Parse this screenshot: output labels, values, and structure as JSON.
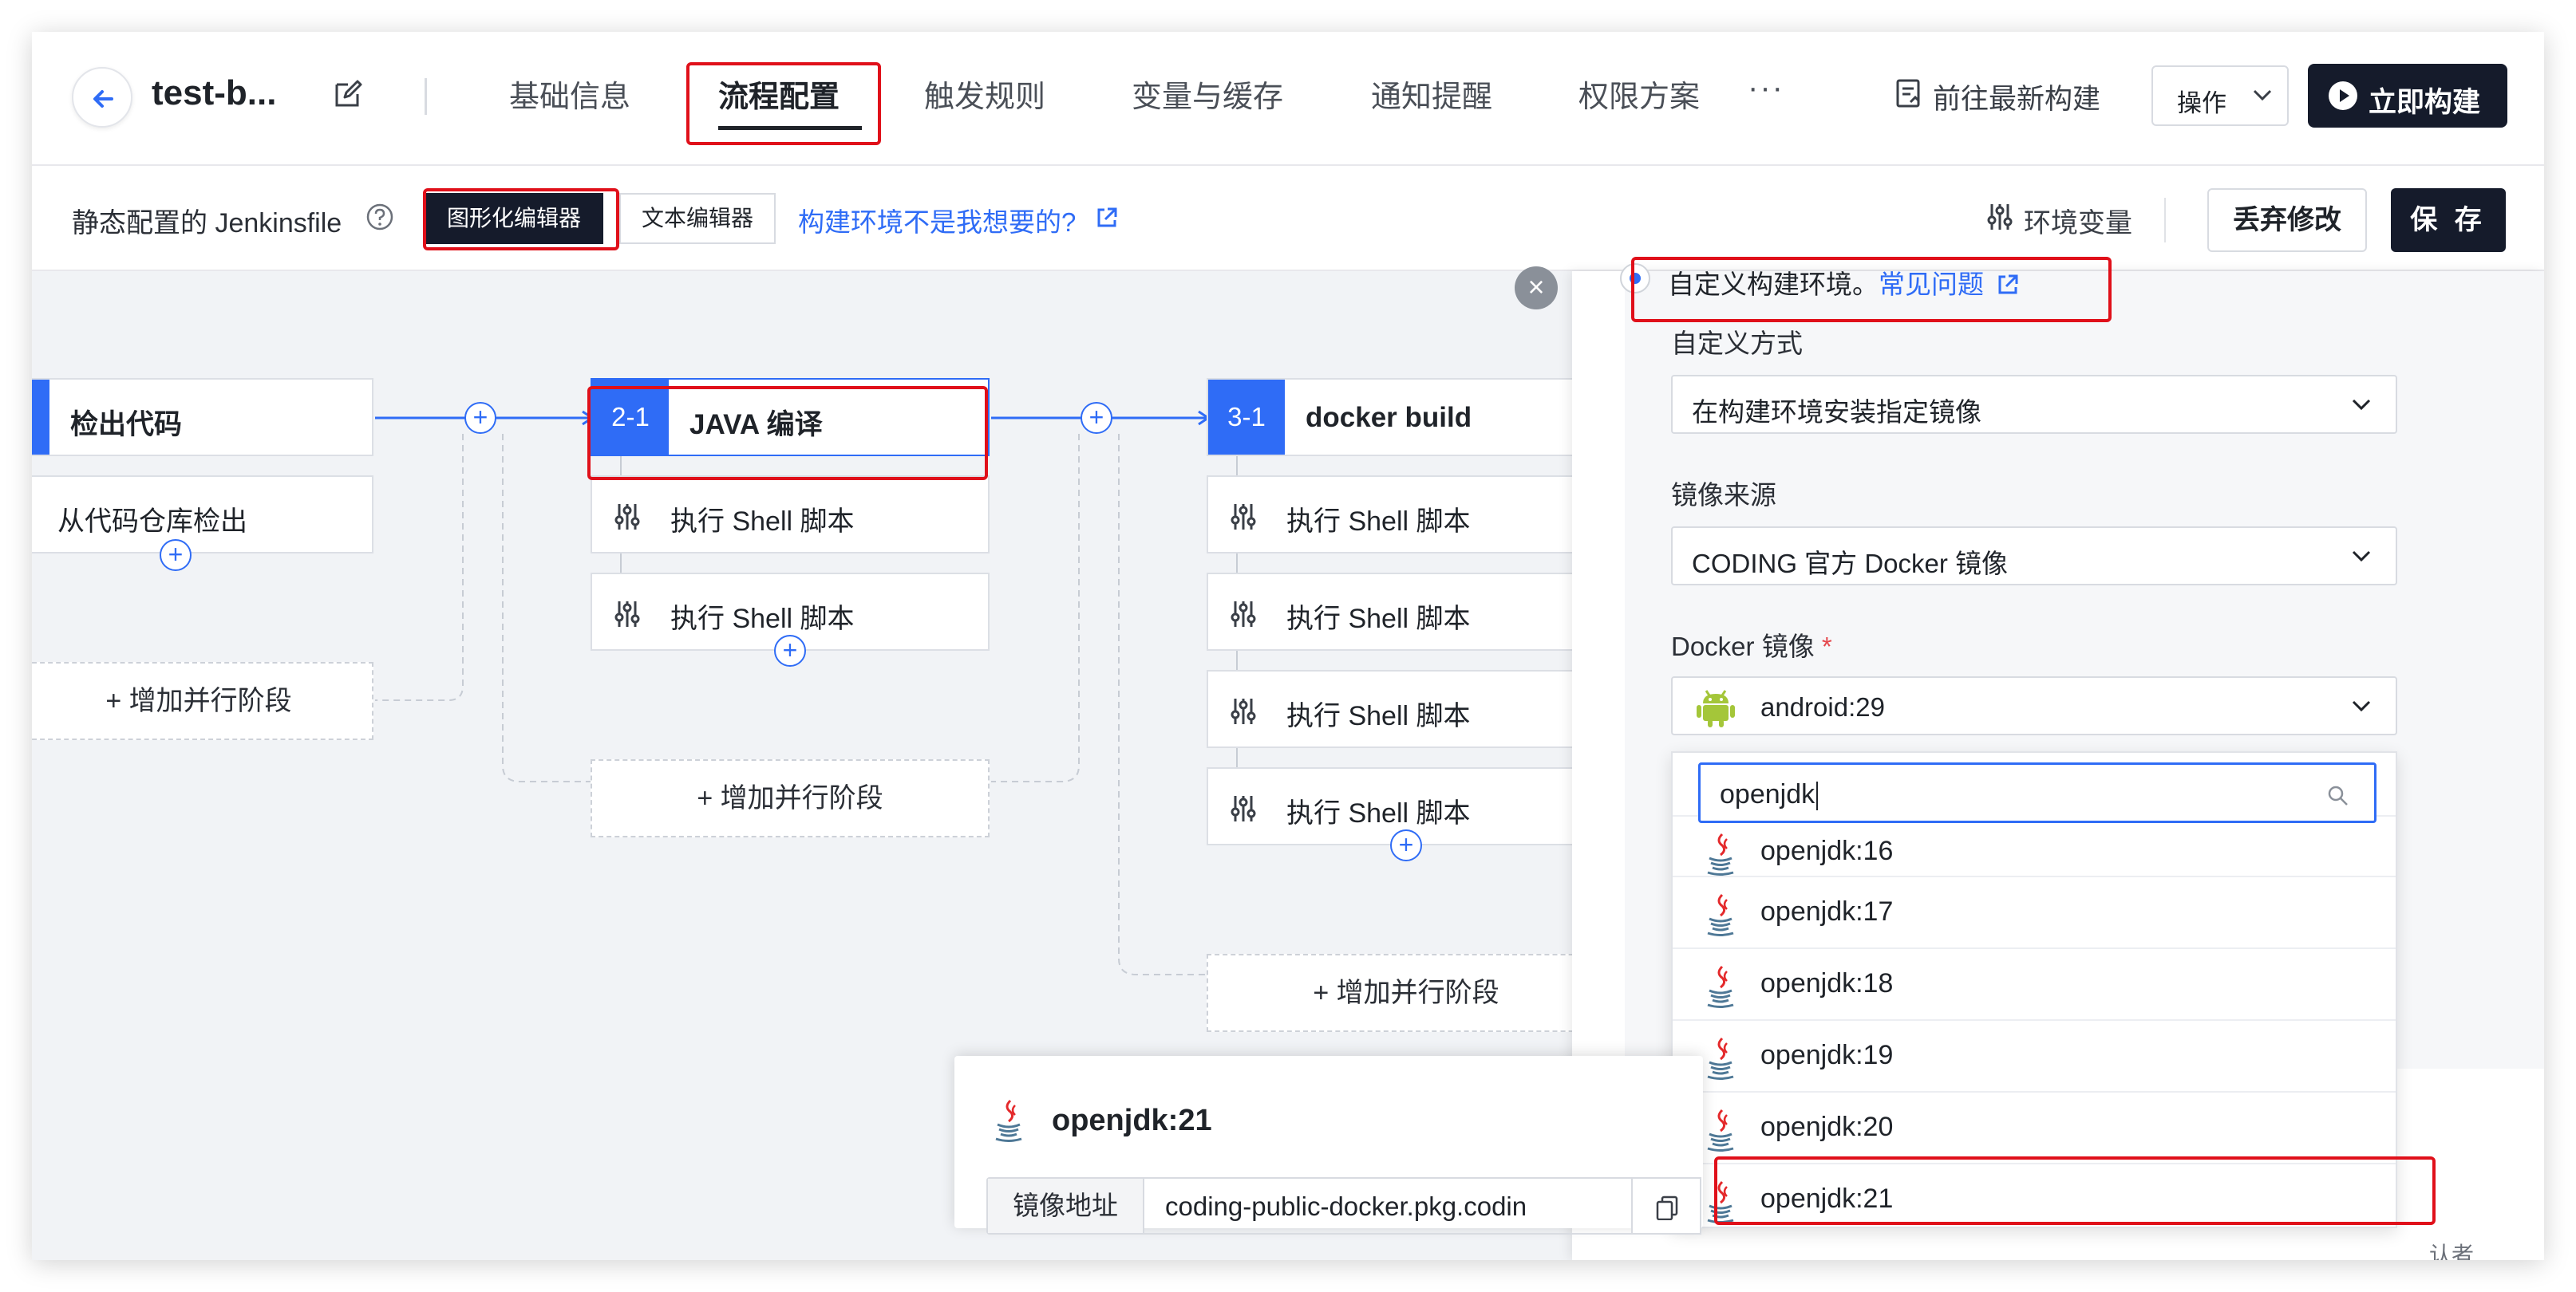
{
  "header": {
    "project_name": "test-b...",
    "tabs": [
      {
        "label": "基础信息"
      },
      {
        "label": "流程配置"
      },
      {
        "label": "触发规则"
      },
      {
        "label": "变量与缓存"
      },
      {
        "label": "通知提醒"
      },
      {
        "label": "权限方案"
      }
    ],
    "more": "···",
    "goto_latest_build": "前往最新构建",
    "operations": "操作",
    "run_build": "立即构建"
  },
  "toolbar": {
    "static_config": "静态配置的 Jenkinsfile",
    "graphical_editor": "图形化编辑器",
    "text_editor": "文本编辑器",
    "env_link": "构建环境不是我想要的?",
    "env_vars": "环境变量",
    "discard": "丢弃修改",
    "save": "保 存"
  },
  "pipeline": {
    "stage1": {
      "title": "检出代码",
      "step": "从代码仓库检出",
      "add_parallel": "+ 增加并行阶段"
    },
    "stage2": {
      "num": "2-1",
      "title": "JAVA 编译",
      "steps": [
        "执行 Shell 脚本",
        "执行 Shell 脚本"
      ],
      "add_parallel": "+ 增加并行阶段"
    },
    "stage3": {
      "num": "3-1",
      "title": "docker build",
      "steps": [
        "执行 Shell 脚本",
        "执行 Shell 脚本",
        "执行 Shell 脚本",
        "执行 Shell 脚本"
      ],
      "add_parallel": "+ 增加并行阶段"
    },
    "plus": "+"
  },
  "panel": {
    "custom_env": "自定义构建环境。",
    "faq": "常见问题",
    "mode_label": "自定义方式",
    "mode_value": "在构建环境安装指定镜像",
    "source_label": "镜像来源",
    "source_value": "CODING 官方 Docker 镜像",
    "image_label": "Docker 镜像",
    "required_mark": "*",
    "image_value": "android:29",
    "search_value": "openjdk",
    "options": [
      "openjdk:16",
      "openjdk:17",
      "openjdk:18",
      "openjdk:19",
      "openjdk:20",
      "openjdk:21"
    ],
    "bg_snippet": "认者"
  },
  "tooltip": {
    "title": "openjdk:21",
    "key": "镜像地址",
    "value": "coding-public-docker.pkg.codin"
  },
  "colors": {
    "accent": "#2f6cf6",
    "dark": "#151b2b",
    "annotation": "#e0101a",
    "android": "#a4c639",
    "java_red": "#e4292b"
  }
}
